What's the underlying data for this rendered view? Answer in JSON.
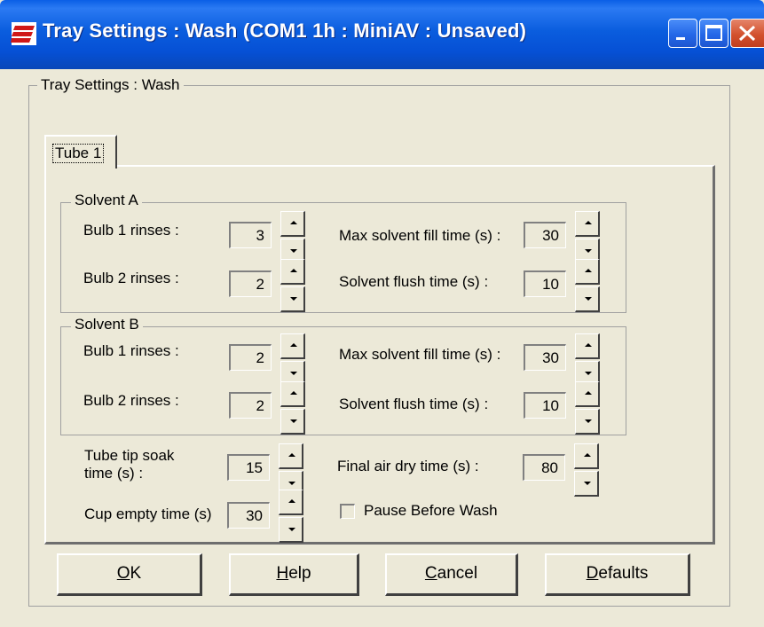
{
  "window": {
    "title": "Tray Settings : Wash  (COM1 1h : MiniAV : Unsaved)"
  },
  "outer_group": {
    "label": "Tray Settings : Wash"
  },
  "tab": {
    "label": "Tube 1"
  },
  "solvent_a": {
    "label": "Solvent A",
    "bulb1": {
      "label": "Bulb 1 rinses :",
      "value": "3"
    },
    "bulb2": {
      "label": "Bulb 2 rinses :",
      "value": "2"
    },
    "max_fill": {
      "label": "Max solvent fill time (s) :",
      "value": "30"
    },
    "flush": {
      "label": "Solvent flush time (s) :",
      "value": "10"
    }
  },
  "solvent_b": {
    "label": "Solvent B",
    "bulb1": {
      "label": "Bulb 1 rinses :",
      "value": "2"
    },
    "bulb2": {
      "label": "Bulb 2 rinses :",
      "value": "2"
    },
    "max_fill": {
      "label": "Max solvent fill time (s) :",
      "value": "30"
    },
    "flush": {
      "label": "Solvent flush time (s) :",
      "value": "10"
    }
  },
  "tube_tip": {
    "label_line1": "Tube tip soak",
    "label_line2": "time (s) :",
    "value": "15"
  },
  "final_air": {
    "label": "Final air dry time (s) :",
    "value": "80"
  },
  "cup_empty": {
    "label": "Cup empty time (s)",
    "value": "30"
  },
  "pause_before_wash": {
    "label": "Pause Before Wash",
    "checked": false
  },
  "buttons": {
    "ok": {
      "mnemonic": "O",
      "rest": "K"
    },
    "help": {
      "mnemonic": "H",
      "rest": "elp"
    },
    "cancel": {
      "mnemonic": "C",
      "rest": "ancel"
    },
    "defaults": {
      "mnemonic": "D",
      "rest": "efaults"
    }
  },
  "colors": {
    "title_bar": "#0A5FE6",
    "dialog_bg": "#ECE9D8",
    "close_button": "#D3512E"
  },
  "icons": [
    "app-logo-icon",
    "minimize-icon",
    "maximize-icon",
    "close-icon",
    "spin-up-icon",
    "spin-down-icon"
  ]
}
